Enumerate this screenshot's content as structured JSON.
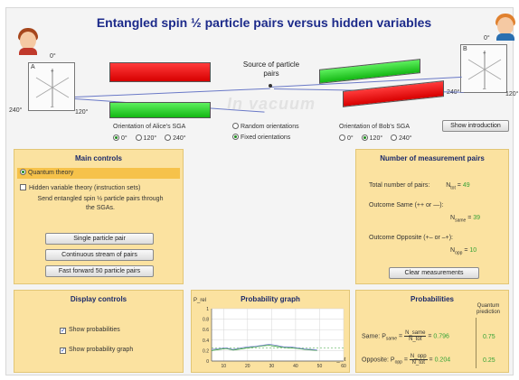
{
  "app": {
    "title": "Entangled spin ½ particle pairs versus hidden variables",
    "colors": {
      "title": "#1c2a8a",
      "panel": "#fbe2a0",
      "magnet_red": "#e11010",
      "magnet_green": "#22c622",
      "beam": "#6a79c7",
      "value_green": "#36a336"
    }
  },
  "apparatus": {
    "source_label": "Source of particle pairs",
    "vacuum_label": "In vacuum",
    "alice_sga": {
      "letter": "A",
      "deg_top": "0°",
      "deg_right": "120°",
      "deg_left": "240°"
    },
    "bob_sga": {
      "letter": "B",
      "deg_top": "0°",
      "deg_right": "120°",
      "deg_left": "240°"
    },
    "alice_orientation": {
      "label": "Orientation of Alice's SGA",
      "options": [
        "0°",
        "120°",
        "240°"
      ],
      "selected": "0°"
    },
    "bob_orientation": {
      "label": "Orientation of Bob's SGA",
      "options": [
        "0°",
        "120°",
        "240°"
      ],
      "selected": "120°"
    },
    "mode": {
      "random": "Random orientations",
      "fixed": "Fixed orientations",
      "selected": "Fixed orientations"
    },
    "show_intro_label": "Show introduction"
  },
  "main_controls": {
    "title": "Main controls",
    "quantum_theory": "Quantum theory",
    "hidden_variable": "Hidden variable theory (instruction sets)",
    "description": "Send entangled spin ½ particle pairs through the SGAs.",
    "buttons": {
      "single": "Single particle pair",
      "continuous": "Continuous stream of pairs",
      "fast_forward": "Fast forward 50 particle pairs"
    }
  },
  "measurement_pairs": {
    "title": "Number of measurement pairs",
    "total_label": "Total number of pairs:",
    "total_sym": "N",
    "total_sub": "tot",
    "total_value": "49",
    "same_label": "Outcome Same (++ or —):",
    "same_sym": "N",
    "same_sub": "same",
    "same_value": "39",
    "opp_label": "Outcome Opposite (+– or –+):",
    "opp_sym": "N",
    "opp_sub": "opp",
    "opp_value": "10",
    "clear_label": "Clear measurements"
  },
  "display_controls": {
    "title": "Display controls",
    "show_probabilities": "Show probabilities",
    "show_probability_graph": "Show probability graph"
  },
  "probability_graph": {
    "title": "Probability graph",
    "y_label": "P_rel",
    "x_label": "N_tot"
  },
  "probabilities": {
    "title": "Probabilities",
    "qp_header": "Quantum prediction",
    "same_label": "Same:",
    "same_sym": "P",
    "same_sub": "same",
    "same_num": "N_same",
    "same_den": "N_tot",
    "same_value": "0.796",
    "same_qp": "0.75",
    "opp_label": "Opposite:",
    "opp_sym": "P",
    "opp_sub": "opp",
    "opp_num": "N_opp",
    "opp_den": "N_tot",
    "opp_value": "0.204",
    "opp_qp": "0.25"
  },
  "chart_data": {
    "type": "line",
    "title": "Probability graph",
    "xlabel": "N_tot",
    "ylabel": "P_rel",
    "xlim": [
      5,
      60
    ],
    "ylim": [
      0,
      1
    ],
    "xticks": [
      10,
      20,
      30,
      40,
      50,
      60
    ],
    "yticks": [
      0,
      0.2,
      0.4,
      0.6,
      0.8,
      1
    ],
    "y_tick_labels": [
      "0",
      "0.2",
      "0.4",
      "0.6",
      "0.8",
      "1"
    ],
    "grid": true,
    "series": [
      {
        "color": "#36a336",
        "x": [
          5,
          8,
          11,
          14,
          17,
          20,
          23,
          26,
          29,
          32,
          35,
          38,
          41,
          44,
          47,
          49
        ],
        "values": [
          0.2,
          0.22,
          0.24,
          0.21,
          0.23,
          0.25,
          0.27,
          0.29,
          0.3,
          0.28,
          0.26,
          0.25,
          0.24,
          0.22,
          0.21,
          0.204
        ]
      },
      {
        "color": "#7a86d0",
        "x": [
          5,
          8,
          11,
          14,
          17,
          20,
          23,
          26,
          29,
          32,
          35,
          38,
          41,
          44,
          47,
          49
        ],
        "values": [
          0.22,
          0.24,
          0.25,
          0.22,
          0.25,
          0.27,
          0.28,
          0.3,
          0.32,
          0.3,
          0.27,
          0.27,
          0.25,
          0.23,
          0.22,
          0.21
        ]
      }
    ],
    "reference_lines": [
      0.25
    ]
  }
}
